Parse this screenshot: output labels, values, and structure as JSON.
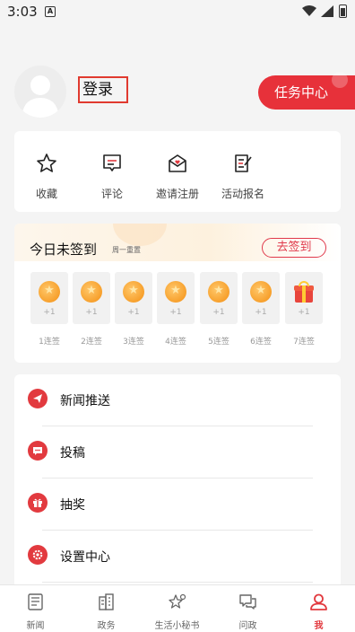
{
  "status": {
    "time": "3:03",
    "notif_glyph": "A"
  },
  "profile": {
    "login_label": "登录",
    "task_label": "任务中心"
  },
  "quick": [
    {
      "label": "收藏",
      "icon": "star-icon"
    },
    {
      "label": "评论",
      "icon": "comment-icon"
    },
    {
      "label": "邀请注册",
      "icon": "invite-icon"
    },
    {
      "label": "活动报名",
      "icon": "signup-icon"
    }
  ],
  "sign": {
    "title": "今日未签到",
    "subtitle": "周一重置",
    "button": "去签到",
    "days": [
      {
        "plus": "+1",
        "label": "1连签"
      },
      {
        "plus": "+1",
        "label": "2连签"
      },
      {
        "plus": "+1",
        "label": "3连签"
      },
      {
        "plus": "+1",
        "label": "4连签"
      },
      {
        "plus": "+1",
        "label": "5连签"
      },
      {
        "plus": "+1",
        "label": "6连签"
      },
      {
        "plus": "+1",
        "label": "7连签"
      }
    ]
  },
  "menu": [
    {
      "label": "新闻推送",
      "icon": "send-icon"
    },
    {
      "label": "投稿",
      "icon": "message-icon"
    },
    {
      "label": "抽奖",
      "icon": "gift-icon"
    },
    {
      "label": "设置中心",
      "icon": "settings-icon"
    }
  ],
  "nav": [
    {
      "label": "新闻",
      "icon": "news-icon"
    },
    {
      "label": "政务",
      "icon": "building-icon"
    },
    {
      "label": "生活小秘书",
      "icon": "assistant-icon"
    },
    {
      "label": "问政",
      "icon": "chat-icon"
    },
    {
      "label": "我",
      "icon": "user-icon"
    }
  ],
  "colors": {
    "accent": "#e23a3f",
    "coin": "#f7a02c"
  }
}
